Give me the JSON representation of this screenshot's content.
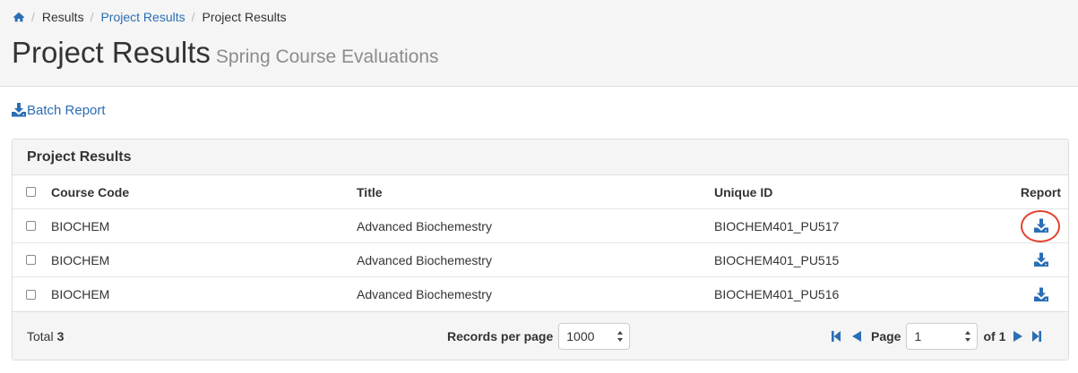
{
  "breadcrumb": {
    "home_icon": "home-icon",
    "items": [
      {
        "label": "Results",
        "link": false
      },
      {
        "label": "Project Results",
        "link": true
      },
      {
        "label": "Project Results",
        "link": false
      }
    ]
  },
  "page": {
    "title": "Project Results",
    "subtitle": "Spring Course Evaluations"
  },
  "batch_report": {
    "label": "Batch Report",
    "icon": "download-icon"
  },
  "panel": {
    "heading": "Project Results",
    "columns": {
      "course_code": "Course Code",
      "title": "Title",
      "unique_id": "Unique ID",
      "report": "Report"
    },
    "rows": [
      {
        "course_code": "BIOCHEM",
        "title": "Advanced Biochemestry",
        "unique_id": "BIOCHEM401_PU517",
        "highlighted": true
      },
      {
        "course_code": "BIOCHEM",
        "title": "Advanced Biochemestry",
        "unique_id": "BIOCHEM401_PU515",
        "highlighted": false
      },
      {
        "course_code": "BIOCHEM",
        "title": "Advanced Biochemestry",
        "unique_id": "BIOCHEM401_PU516",
        "highlighted": false
      }
    ],
    "footer": {
      "total_label": "Total",
      "total_value": "3",
      "records_per_page_label": "Records per page",
      "records_per_page_value": "1000",
      "page_label": "Page",
      "page_value": "1",
      "of_label": "of 1"
    }
  },
  "colors": {
    "accent": "#2a6eb5",
    "highlight_ring": "#e3412e",
    "header_bg": "#f5f5f5"
  }
}
